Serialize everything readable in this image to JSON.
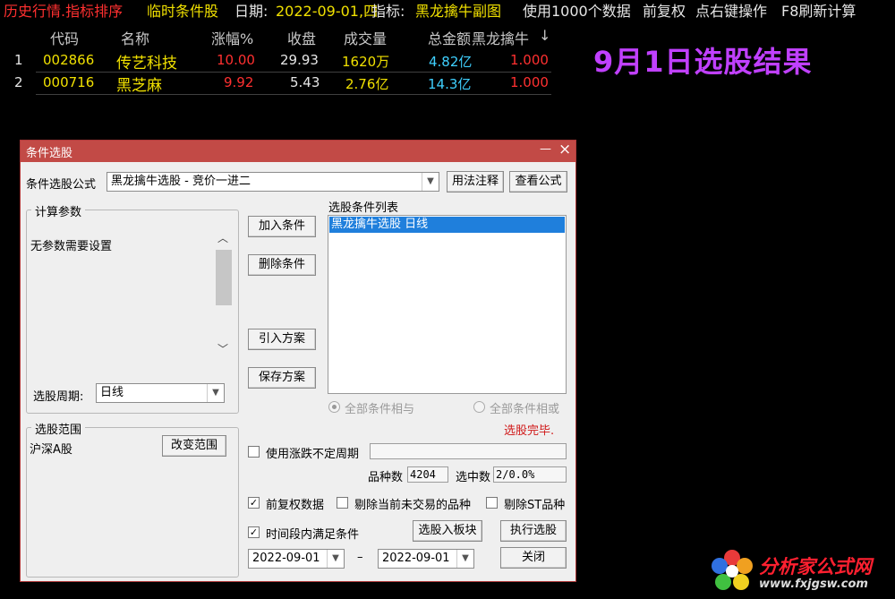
{
  "topbar": {
    "title": "历史行情.指标排序",
    "mode": "临时条件股",
    "date_label": "日期:",
    "date_value": "2022-09-01,四",
    "indicator_label": "指标:",
    "indicator_value": "黑龙擒牛副图",
    "data_info": "使用1000个数据",
    "rights": "前复权",
    "right_click": "点右键操作",
    "refresh": "F8刷新计算"
  },
  "table": {
    "headers": [
      "代码",
      "名称",
      "涨幅%",
      "收盘",
      "成交量",
      "总金额",
      "黑龙擒牛",
      "↓"
    ],
    "rows": [
      {
        "idx": "1",
        "code": "002866",
        "name": "传艺科技",
        "change": "10.00",
        "close": "29.93",
        "volume": "1620万",
        "amount": "4.82亿",
        "indicator": "1.000"
      },
      {
        "idx": "2",
        "code": "000716",
        "name": "黑芝麻",
        "change": "9.92",
        "close": "5.43",
        "volume": "2.76亿",
        "amount": "14.3亿",
        "indicator": "1.000"
      }
    ]
  },
  "banner": "9月1日选股结果",
  "dialog": {
    "title": "条件选股",
    "minimize": "—",
    "close": "×",
    "formula_label": "条件选股公式",
    "formula_value": "黑龙擒牛选股 - 竞价一进二",
    "usage_button": "用法注释",
    "view_button": "查看公式",
    "params_legend": "计算参数",
    "params_text": "无参数需要设置",
    "period_label": "选股周期:",
    "period_value": "日线",
    "add_button": "加入条件",
    "delete_button": "删除条件",
    "import_button": "引入方案",
    "save_button": "保存方案",
    "list_label": "选股条件列表",
    "list_items": [
      "黑龙擒牛选股  日线"
    ],
    "radio_and": "全部条件相与",
    "radio_or": "全部条件相或",
    "status": "选股完毕.",
    "range_legend": "选股范围",
    "range_value": "沪深A股",
    "change_range_button": "改变范围",
    "volatile_period_label": "使用涨跌不定周期",
    "count_label": "品种数",
    "count_value": "4204",
    "selected_label": "选中数",
    "selected_value": "2/0.0%",
    "adjusted_label": "前复权数据",
    "exclude_untraded_label": "剔除当前未交易的品种",
    "exclude_st_label": "剔除ST品种",
    "time_cond_label": "时间段内满足条件",
    "add_block_button": "选股入板块",
    "execute_button": "执行选股",
    "date_from": "2022-09-01",
    "date_dash": "–",
    "date_to": "2022-09-01",
    "close_button": "关闭"
  },
  "watermark": {
    "text": "分析家公式网",
    "url": "www.fxjgsw.com"
  },
  "colors": {
    "up": "#ff3030",
    "accent_title": "#c24a46",
    "banner": "#c040ff",
    "selection": "#1f7fdc"
  }
}
